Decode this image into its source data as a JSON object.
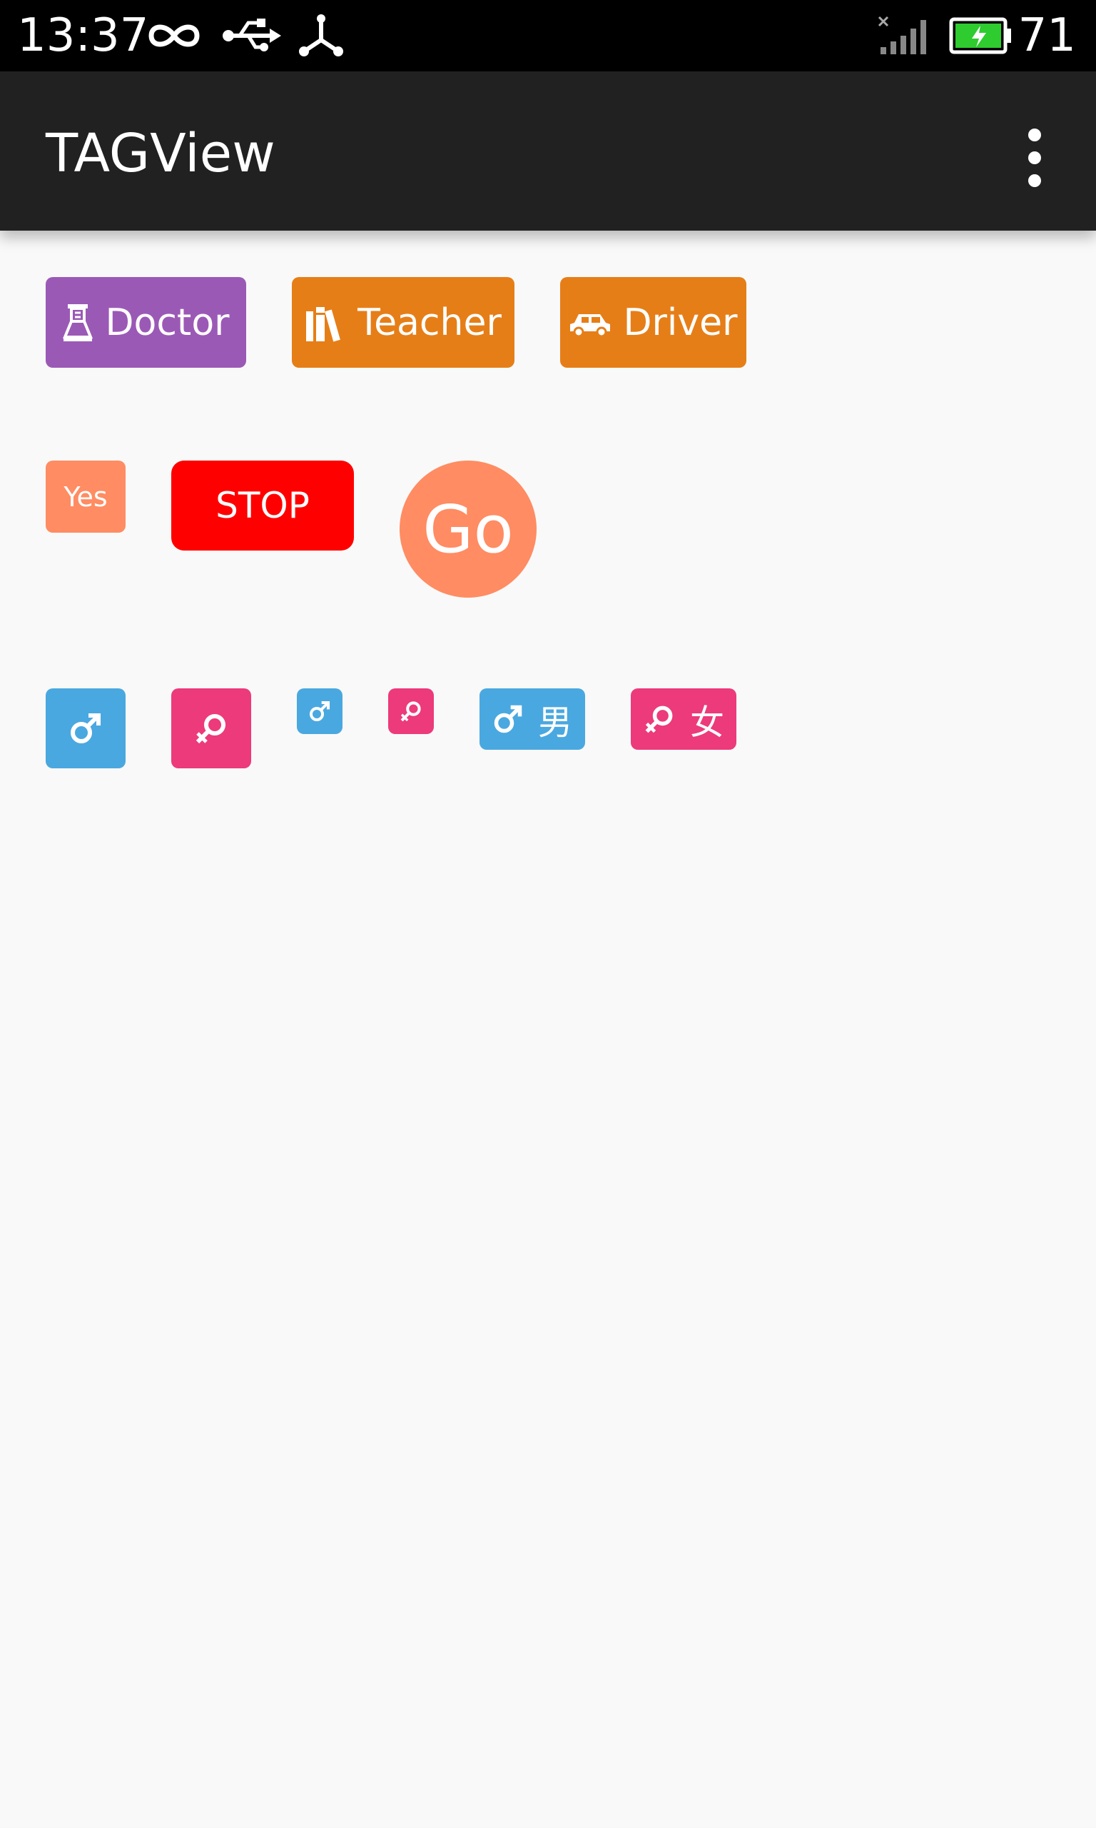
{
  "status_bar": {
    "time": "13:37",
    "battery_percent": "71",
    "icons": [
      "infinity-icon",
      "usb-icon",
      "hub-icon",
      "signal-no-sim-icon",
      "battery-charging-icon"
    ]
  },
  "app_bar": {
    "title": "TAGView",
    "menu_icon": "overflow-menu-icon"
  },
  "row1": [
    {
      "label": "Doctor",
      "icon": "flask-icon",
      "color": "#9b59b6"
    },
    {
      "label": "Teacher",
      "icon": "books-icon",
      "color": "#e67e17"
    },
    {
      "label": "Driver",
      "icon": "car-icon",
      "color": "#e67e17"
    }
  ],
  "row2": {
    "yes": {
      "label": "Yes",
      "color": "#ff8c62"
    },
    "stop": {
      "label": "STOP",
      "color": "#ff0000"
    },
    "go": {
      "label": "Go",
      "color": "#ff8c62"
    }
  },
  "row3": {
    "male_color": "#4aa8e0",
    "female_color": "#ec3a7b",
    "tags": [
      {
        "icon": "male-icon"
      },
      {
        "icon": "female-icon"
      },
      {
        "icon": "male-icon"
      },
      {
        "icon": "female-icon"
      },
      {
        "icon": "male-icon",
        "label": "男"
      },
      {
        "icon": "female-icon",
        "label": "女"
      }
    ]
  }
}
